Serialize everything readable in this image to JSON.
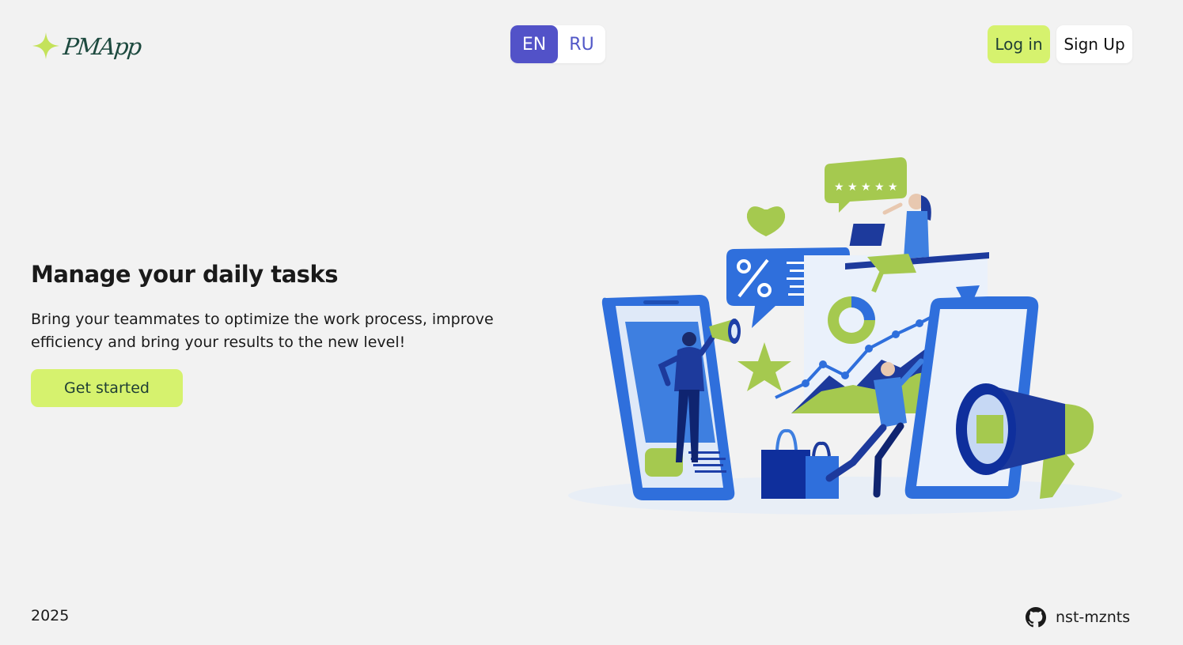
{
  "header": {
    "logo_text": "PMApp",
    "languages": [
      {
        "label": "EN",
        "active": true
      },
      {
        "label": "RU",
        "active": false
      }
    ],
    "login_label": "Log in",
    "signup_label": "Sign Up"
  },
  "hero": {
    "title": "Manage your daily tasks",
    "description": "Bring your teammates to optimize the work process, improve efficiency and bring your results to the new level!",
    "cta_label": "Get started",
    "illustration_icon": "team-marketing-illustration"
  },
  "footer": {
    "year": "2025",
    "github_label": "nst-mznts",
    "github_icon": "github-icon"
  },
  "colors": {
    "background": "#f2f2f2",
    "accent_lime": "#d6f26e",
    "accent_indigo": "#5252c8",
    "illustration_blue": "#2f6fdc",
    "illustration_green": "#a5c94f",
    "logo_green": "#1d4a3f"
  }
}
